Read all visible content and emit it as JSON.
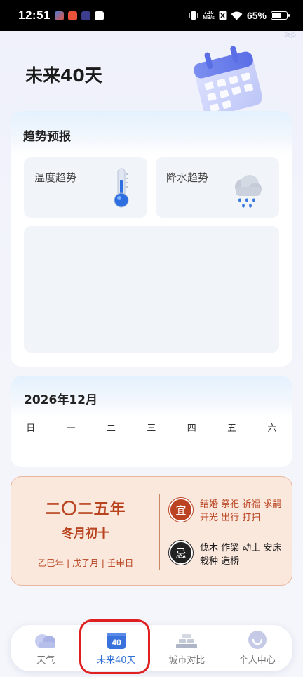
{
  "status_bar": {
    "time": "12:51",
    "speed_value": "7.10",
    "speed_unit": "MB/s",
    "battery": "65%",
    "battery_level": 0.65
  },
  "badge": "3ej5",
  "page_title": "未来40天",
  "trend": {
    "title": "趋势预报",
    "temperature_label": "温度趋势",
    "precipitation_label": "降水趋势"
  },
  "month": {
    "title": "2026年12月",
    "weekdays": [
      "日",
      "一",
      "二",
      "三",
      "四",
      "五",
      "六"
    ]
  },
  "almanac": {
    "year": "二〇二五年",
    "date": "冬月初十",
    "ganzhi": "乙巳年 | 戊子月 | 壬申日",
    "yi_mark": "宜",
    "yi_text": "结婚 祭祀 祈福 求嗣 开光 出行 打扫",
    "ji_mark": "忌",
    "ji_text": "伐木 作梁 动土 安床 栽种 造桥"
  },
  "nav": {
    "items": [
      {
        "label": "天气",
        "icon": "cloud-icon"
      },
      {
        "label": "未来40天",
        "icon": "calendar-40-icon",
        "icon_text": "40"
      },
      {
        "label": "城市对比",
        "icon": "city-compare-icon"
      },
      {
        "label": "个人中心",
        "icon": "profile-icon"
      }
    ],
    "active_index": 1
  },
  "colors": {
    "accent": "#2f6fd6",
    "almanac_red": "#b8431f",
    "almanac_bg": "#fbe8dd",
    "highlight": "#e02020"
  }
}
